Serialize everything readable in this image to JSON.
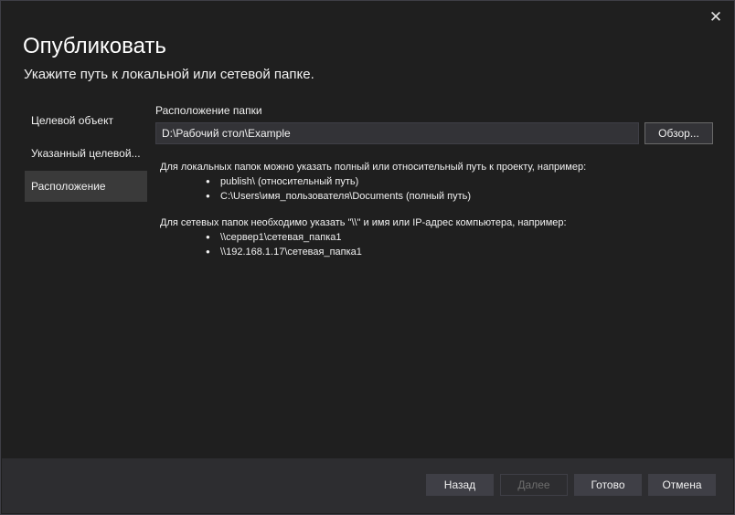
{
  "dialog": {
    "close_glyph": "✕",
    "title": "Опубликовать",
    "subtitle": "Укажите путь к локальной или сетевой папке."
  },
  "nav": {
    "items": [
      {
        "label": "Целевой объект",
        "active": false
      },
      {
        "label": "Указанный целевой...",
        "active": false
      },
      {
        "label": "Расположение",
        "active": true
      }
    ]
  },
  "location": {
    "field_label": "Расположение папки",
    "path_value": "D:\\Рабочий стол\\Example",
    "browse_label": "Обзор..."
  },
  "help": {
    "local_intro": "Для локальных папок можно указать полный или относительный путь к проекту, например:",
    "local_examples": [
      "publish\\ (относительный путь)",
      "C:\\Users\\имя_пользователя\\Documents (полный путь)"
    ],
    "network_intro": "Для сетевых папок необходимо указать \"\\\\\" и имя или IP-адрес компьютера, например:",
    "network_examples": [
      "\\\\сервер1\\сетевая_папка1",
      "\\\\192.168.1.17\\сетевая_папка1"
    ]
  },
  "footer": {
    "back_label": "Назад",
    "next_label": "Далее",
    "finish_label": "Готово",
    "cancel_label": "Отмена"
  }
}
